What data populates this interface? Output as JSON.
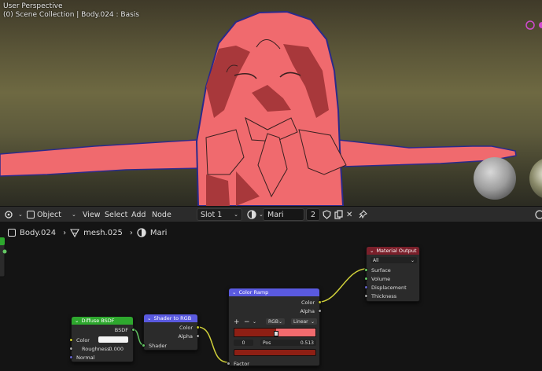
{
  "viewport": {
    "mode_label": "User Perspective",
    "collection_label": "(0) Scene Collection | Body.024 : Basis"
  },
  "header": {
    "editor_type_icon": "node-editor-icon",
    "object_label": "Object",
    "menu": [
      "View",
      "Select",
      "Add",
      "Node"
    ],
    "slot_label": "Slot 1",
    "material_name": "Mari",
    "users_count": "2"
  },
  "breadcrumb": {
    "object": "Body.024",
    "mesh": "mesh.025",
    "material": "Mari"
  },
  "nodes": {
    "diffuse": {
      "title": "Diffuse BSDF",
      "output_label": "BSDF",
      "color_label": "Color",
      "roughness_label": "Roughness",
      "roughness_value": "0.000",
      "normal_label": "Normal"
    },
    "shader_to_rgb": {
      "title": "Shader to RGB",
      "out_color": "Color",
      "out_alpha": "Alpha",
      "in_shader": "Shader"
    },
    "color_ramp": {
      "title": "Color Ramp",
      "out_color": "Color",
      "out_alpha": "Alpha",
      "add_btn": "+",
      "remove_btn": "−",
      "color_mode": "RGB",
      "interpolation": "Linear",
      "stop_index": "0",
      "pos_label": "Pos",
      "pos_value": "0.513",
      "in_factor": "Factor"
    },
    "material_output": {
      "title": "Material Output",
      "target": "All",
      "surface": "Surface",
      "volume": "Volume",
      "displacement": "Displacement",
      "thickness": "Thickness"
    }
  },
  "colors": {
    "character_fill": "#f06a6e",
    "character_shadow": "#a8383b",
    "outline": "#2a2a8a",
    "diffuse_header": "#2ea82e",
    "shader_header": "#5a5ae0",
    "ramp_header": "#5a5ae0",
    "output_header": "#7a1f2a",
    "ramp_start": "#8e1f14",
    "ramp_end": "#f26b6e"
  }
}
